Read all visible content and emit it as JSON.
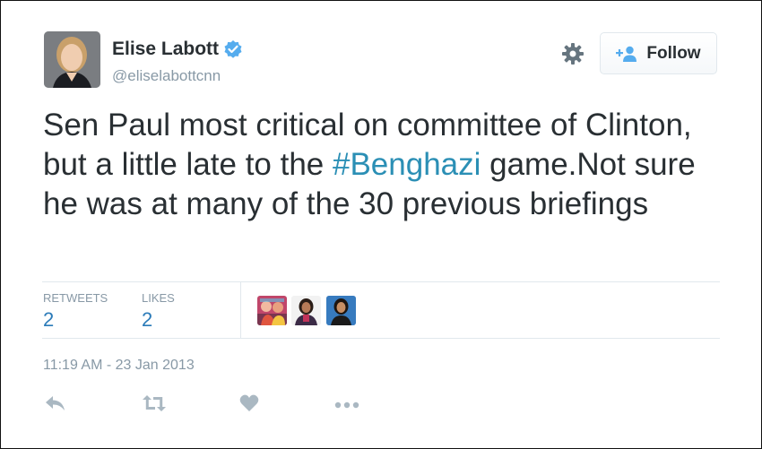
{
  "user": {
    "name": "Elise Labott",
    "handle": "@eliselabottcnn"
  },
  "follow": {
    "label": "Follow"
  },
  "tweet": {
    "text_before": "Sen Paul most critical on committee of Clinton, but a little late to the ",
    "hashtag": "#Benghazi",
    "text_after": " game.Not sure he was at many of the 30 previous briefings"
  },
  "stats": {
    "retweets_label": "RETWEETS",
    "retweets_count": "2",
    "likes_label": "LIKES",
    "likes_count": "2"
  },
  "timestamp": "11:19 AM - 23 Jan 2013",
  "colors": {
    "link": "#2b8fb5",
    "count": "#2b7bb9",
    "muted": "#8899a6",
    "verified": "#55acee",
    "icon": "#aab8c2"
  },
  "icons": {
    "verified": "verified-badge-icon",
    "settings": "gear-icon",
    "follow": "follow-user-icon",
    "reply": "reply-icon",
    "retweet": "retweet-icon",
    "like": "heart-icon",
    "more": "more-icon"
  }
}
